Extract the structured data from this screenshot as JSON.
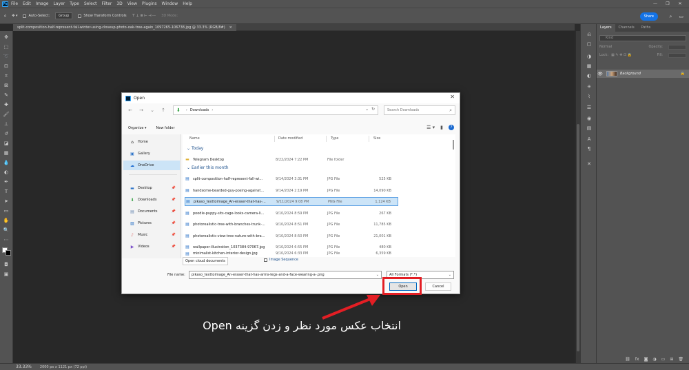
{
  "app": {
    "logo": "Ps"
  },
  "menu": [
    "File",
    "Edit",
    "Image",
    "Layer",
    "Type",
    "Select",
    "Filter",
    "3D",
    "View",
    "Plugins",
    "Window",
    "Help"
  ],
  "window_controls": {
    "minimize": "—",
    "maximize": "❐",
    "close": "✕"
  },
  "options_bar": {
    "auto_select": "Auto-Select:",
    "group": "Group",
    "show_transform": "Show Transform Controls",
    "mode_3d": "3D Mode:",
    "share": "Share"
  },
  "doc_tab": {
    "title": "split-composition-half-represent-fall-winter-using-closeup-photo-oak-tree-again_1097265-106738.jpg @ 33.3% (RGB/8#)",
    "close": "×"
  },
  "status": {
    "zoom": "33.33%",
    "info": "2000 px x 1121 px (72 ppi)"
  },
  "panel": {
    "tabs": [
      "Layers",
      "Channels",
      "Paths"
    ],
    "search_placeholder": "Kind",
    "blend": "Normal",
    "opacity_label": "Opacity:",
    "lock_label": "Lock:",
    "fill_label": "Fill:",
    "layer_name": "Background"
  },
  "dialog": {
    "title": "Open",
    "close": "✕",
    "address": "Downloads",
    "search_placeholder": "Search Downloads",
    "organize": "Organize ▾",
    "new_folder": "New folder",
    "nav": {
      "home": "Home",
      "gallery": "Gallery",
      "onedrive": "OneDrive",
      "desktop": "Desktop",
      "downloads": "Downloads",
      "documents": "Documents",
      "pictures": "Pictures",
      "music": "Music",
      "videos": "Videos"
    },
    "columns": {
      "name": "Name",
      "date": "Date modified",
      "type": "Type",
      "size": "Size"
    },
    "groups": {
      "today": "Today",
      "earlier": "Earlier this month"
    },
    "folder": {
      "name": "Telegram Desktop",
      "date": "8/22/2024 7:22 PM",
      "type": "File folder",
      "size": ""
    },
    "files": [
      {
        "name": "split-composition-half-represent-fall-wi...",
        "date": "9/14/2024 3:31 PM",
        "type": "JPG File",
        "size": "525 KB"
      },
      {
        "name": "handsome-bearded-guy-posing-against...",
        "date": "9/14/2024 2:19 PM",
        "type": "JPG File",
        "size": "14,090 KB"
      },
      {
        "name": "pikaso_texttoimage_An-eraser-that-has-...",
        "date": "9/11/2024 9:08 PM",
        "type": "PNG File",
        "size": "1,124 KB"
      },
      {
        "name": "poodle-puppy-sits-cage-looks-camera-li...",
        "date": "9/10/2024 8:59 PM",
        "type": "JPG File",
        "size": "267 KB"
      },
      {
        "name": "photorealistic-tree-with-branches-trunk-...",
        "date": "9/10/2024 8:51 PM",
        "type": "JPG File",
        "size": "11,785 KB"
      },
      {
        "name": "photorealistic-view-tree-nature-with-bra...",
        "date": "9/10/2024 8:50 PM",
        "type": "JPG File",
        "size": "21,001 KB"
      },
      {
        "name": "wallpaper-illustration_1037384-97067.jpg",
        "date": "9/10/2024 6:55 PM",
        "type": "JPG File",
        "size": "480 KB"
      },
      {
        "name": "minimalist-kitchen-interior-design.jpg",
        "date": "9/10/2024 6:33 PM",
        "type": "JPG File",
        "size": "6,359 KB"
      }
    ],
    "cloud_btn": "Open cloud documents",
    "image_sequence": "Image Sequence",
    "file_name_label": "File name:",
    "file_name_value": "pikaso_texttoimage_An-eraser-that-has-arms-legs-and-a-face-wearing-a-.png",
    "format": "All Formats (*.*)",
    "open": "Open",
    "cancel": "Cancel"
  },
  "caption": "انتخاب عکس مورد نظر و زدن گزینه Open",
  "colors": {
    "annotation_red": "#e31e24",
    "ps_gray": "#535353",
    "canvas": "#282828",
    "share_blue": "#1473e6"
  }
}
